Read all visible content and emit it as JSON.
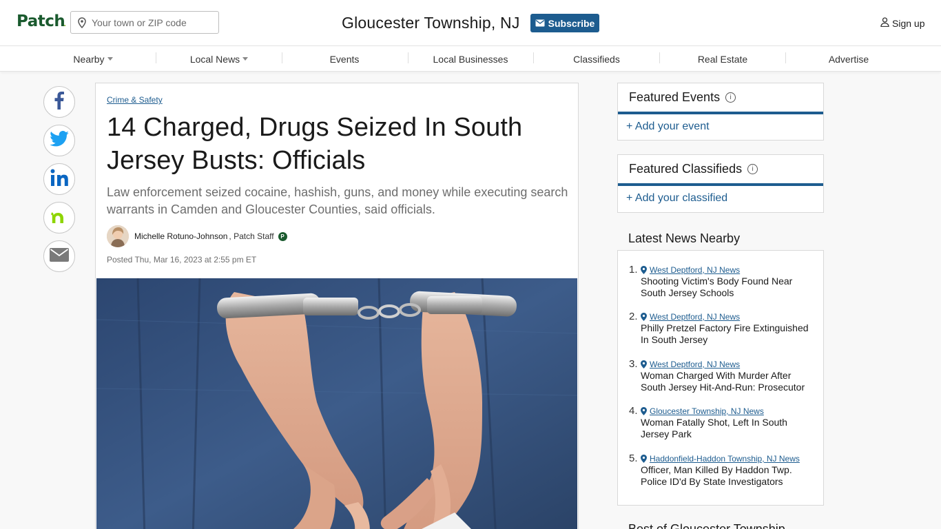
{
  "header": {
    "logo": "Patch",
    "search_placeholder": "Your town or ZIP code",
    "town": "Gloucester Township, NJ",
    "subscribe_label": "Subscribe",
    "signup_label": "Sign up"
  },
  "nav": {
    "items": [
      {
        "label": "Nearby",
        "dropdown": true
      },
      {
        "label": "Local News",
        "dropdown": true
      },
      {
        "label": "Events",
        "dropdown": false
      },
      {
        "label": "Local Businesses",
        "dropdown": false
      },
      {
        "label": "Classifieds",
        "dropdown": false
      },
      {
        "label": "Real Estate",
        "dropdown": false
      },
      {
        "label": "Advertise",
        "dropdown": false
      }
    ]
  },
  "share": [
    "facebook-icon",
    "twitter-icon",
    "linkedin-icon",
    "nextdoor-icon",
    "email-icon"
  ],
  "article": {
    "category": "Crime & Safety",
    "headline": "14 Charged, Drugs Seized In South Jersey Busts: Officials",
    "dek": "Law enforcement seized cocaine, hashish, guns, and money while executing search warrants in Camden and Gloucester Counties, said officials.",
    "author": "Michelle Rotuno-Johnson",
    "author_role": ", Patch Staff",
    "badge": "P",
    "posted": "Posted Thu, Mar 16, 2023 at 2:55 pm ET"
  },
  "sidebar": {
    "featured_events": {
      "title": "Featured Events",
      "add_label": "+ Add your event"
    },
    "featured_classifieds": {
      "title": "Featured Classifieds",
      "add_label": "+ Add your classified"
    },
    "latest_title": "Latest News Nearby",
    "latest": [
      {
        "num": "1.",
        "location": "West Deptford, NJ News",
        "title": "Shooting Victim's Body Found Near South Jersey Schools"
      },
      {
        "num": "2.",
        "location": "West Deptford, NJ News",
        "title": "Philly Pretzel Factory Fire Extinguished In South Jersey"
      },
      {
        "num": "3.",
        "location": "West Deptford, NJ News",
        "title": "Woman Charged With Murder After South Jersey Hit-And-Run: Prosecutor"
      },
      {
        "num": "4.",
        "location": "Gloucester Township, NJ News",
        "title": "Woman Fatally Shot, Left In South Jersey Park"
      },
      {
        "num": "5.",
        "location": "Haddonfield-Haddon Township, NJ News",
        "title": "Officer, Man Killed By Haddon Twp. Police ID'd By State Investigators"
      }
    ],
    "best_title": "Best of Gloucester Township"
  },
  "colors": {
    "brand_green": "#1a5a2e",
    "accent_blue": "#1d5c8f"
  }
}
